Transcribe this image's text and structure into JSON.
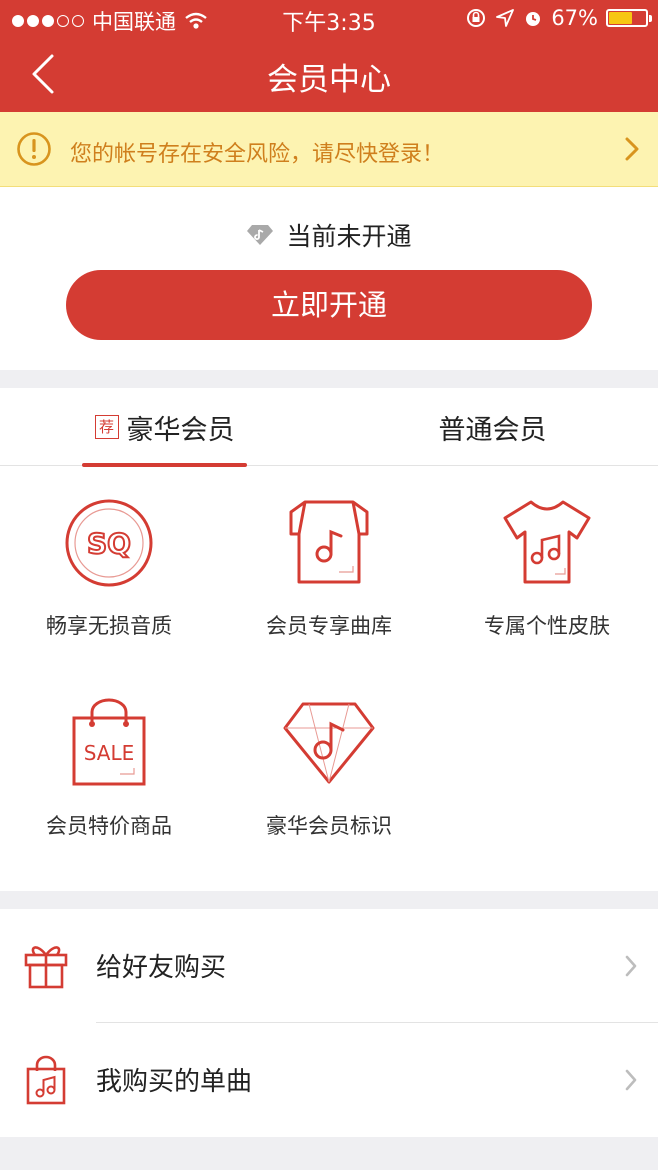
{
  "status_bar": {
    "carrier": "中国联通",
    "time": "下午3:35",
    "battery": "67%",
    "battery_level": 0.67
  },
  "nav": {
    "title": "会员中心"
  },
  "warning": {
    "text": "您的帐号存在安全风险，请尽快登录！"
  },
  "membership": {
    "status": "当前未开通",
    "open_button": "立即开通"
  },
  "tabs": [
    {
      "label": "豪华会员",
      "badge": "荐"
    },
    {
      "label": "普通会员"
    }
  ],
  "benefits": [
    {
      "label": "畅享无损音质",
      "icon": "sq-quality-icon",
      "icon_text": "SQ"
    },
    {
      "label": "会员专享曲库",
      "icon": "music-library-icon"
    },
    {
      "label": "专属个性皮肤",
      "icon": "tshirt-skin-icon"
    },
    {
      "label": "会员特价商品",
      "icon": "sale-bag-icon",
      "icon_text": "SALE"
    },
    {
      "label": "豪华会员标识",
      "icon": "diamond-badge-icon"
    }
  ],
  "list": [
    {
      "label": "给好友购买",
      "icon": "gift-icon"
    },
    {
      "label": "我购买的单曲",
      "icon": "music-bag-icon"
    }
  ],
  "colors": {
    "accent": "#d43c33",
    "warning_bg": "#fdf3b1",
    "warning_text": "#cf7f1d"
  }
}
